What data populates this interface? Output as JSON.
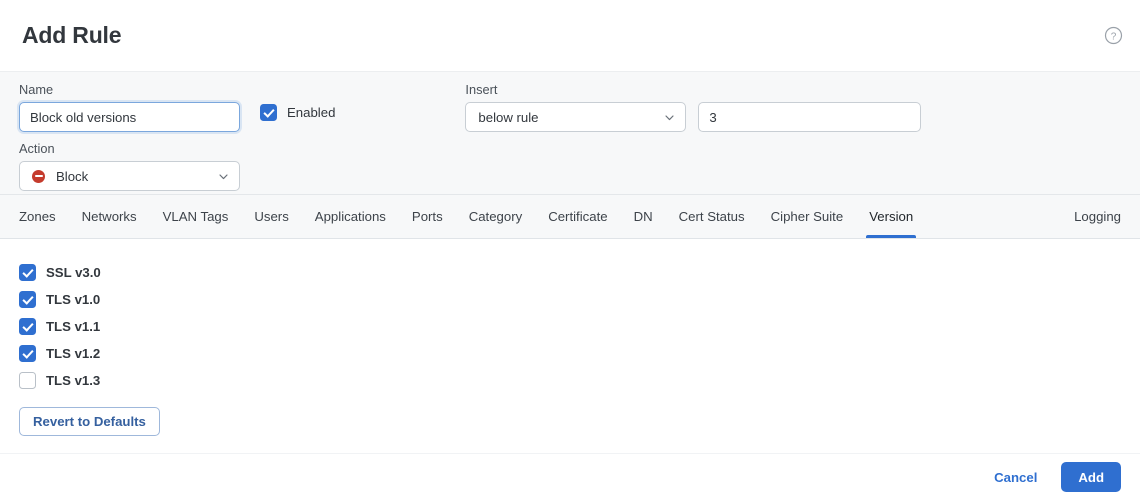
{
  "header": {
    "title": "Add Rule",
    "help_icon": "question-circle-icon"
  },
  "form": {
    "name": {
      "label": "Name",
      "value": "Block old versions",
      "placeholder": ""
    },
    "enabled": {
      "label": "Enabled",
      "checked": true
    },
    "action": {
      "label": "Action",
      "value": "Block",
      "icon": "block-deny-icon",
      "icon_color": "#c53b2d",
      "chevron": "chevron-down-icon"
    },
    "insert": {
      "label": "Insert",
      "position_value": "below rule",
      "chevron": "chevron-down-icon",
      "rule_number": "3"
    }
  },
  "tabs": {
    "items": [
      {
        "label": "Zones",
        "active": false
      },
      {
        "label": "Networks",
        "active": false
      },
      {
        "label": "VLAN Tags",
        "active": false
      },
      {
        "label": "Users",
        "active": false
      },
      {
        "label": "Applications",
        "active": false
      },
      {
        "label": "Ports",
        "active": false
      },
      {
        "label": "Category",
        "active": false
      },
      {
        "label": "Certificate",
        "active": false
      },
      {
        "label": "DN",
        "active": false
      },
      {
        "label": "Cert Status",
        "active": false
      },
      {
        "label": "Cipher Suite",
        "active": false
      },
      {
        "label": "Version",
        "active": true
      }
    ],
    "right_tab": {
      "label": "Logging",
      "active": false
    },
    "active_underline_color": "#2f6fd0"
  },
  "content": {
    "versions": [
      {
        "label": "SSL v3.0",
        "checked": true
      },
      {
        "label": "TLS v1.0",
        "checked": true
      },
      {
        "label": "TLS v1.1",
        "checked": true
      },
      {
        "label": "TLS v1.2",
        "checked": true
      },
      {
        "label": "TLS v1.3",
        "checked": false
      }
    ],
    "revert_label": "Revert to Defaults"
  },
  "footer": {
    "cancel_label": "Cancel",
    "add_label": "Add",
    "primary_color": "#2f6fd0"
  }
}
